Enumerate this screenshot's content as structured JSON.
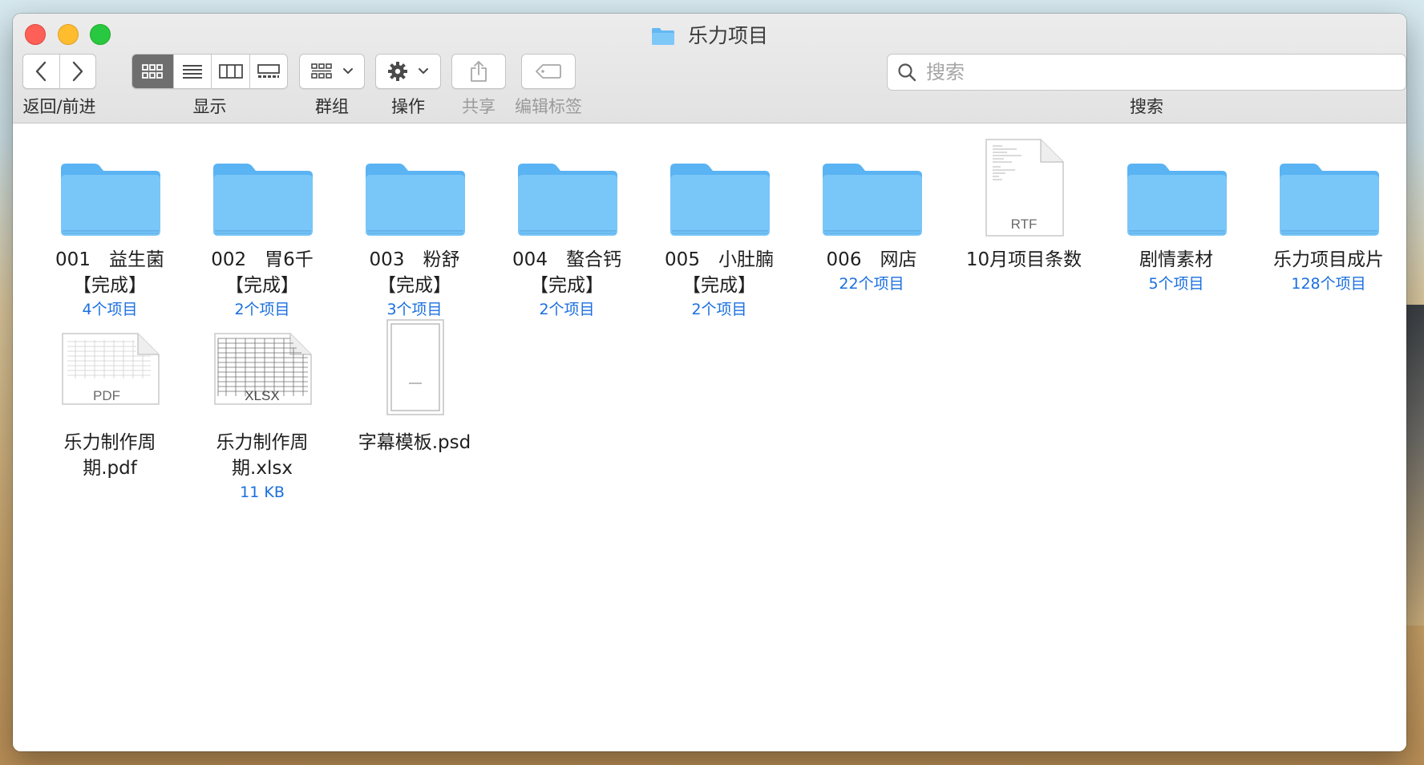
{
  "window": {
    "title": "乐力项目"
  },
  "toolbar": {
    "nav_label": "返回/前进",
    "view_label": "显示",
    "group_label": "群组",
    "action_label": "操作",
    "share_label": "共享",
    "tags_label": "编辑标签",
    "search_label": "搜索",
    "search_placeholder": "搜索",
    "active_view": "icon"
  },
  "items": [
    {
      "type": "folder",
      "name_line1": "001　益生菌",
      "name_line2": "【完成】",
      "meta": "4个项目"
    },
    {
      "type": "folder",
      "name_line1": "002　胃6千",
      "name_line2": "【完成】",
      "meta": "2个项目"
    },
    {
      "type": "folder",
      "name_line1": "003　粉舒",
      "name_line2": "【完成】",
      "meta": "3个项目"
    },
    {
      "type": "folder",
      "name_line1": "004　螯合钙",
      "name_line2": "【完成】",
      "meta": "2个项目"
    },
    {
      "type": "folder",
      "name_line1": "005　小肚腩",
      "name_line2": "【完成】",
      "meta": "2个项目"
    },
    {
      "type": "folder",
      "name_line1": "006　网店",
      "name_line2": "",
      "meta": "22个项目"
    },
    {
      "type": "rtf",
      "name_line1": "10月项目条数",
      "name_line2": "",
      "meta": "",
      "badge": "RTF"
    },
    {
      "type": "folder",
      "name_line1": "剧情素材",
      "name_line2": "",
      "meta": "5个项目"
    },
    {
      "type": "folder",
      "name_line1": "乐力项目成片",
      "name_line2": "",
      "meta": "128个项目"
    },
    {
      "type": "pdf",
      "name_line1": "乐力制作周",
      "name_line2": "期.pdf",
      "meta": "",
      "badge": "PDF"
    },
    {
      "type": "xlsx",
      "name_line1": "乐力制作周",
      "name_line2": "期.xlsx",
      "meta": "11 KB",
      "badge": "XLSX"
    },
    {
      "type": "psd",
      "name_line1": "字幕模板.psd",
      "name_line2": "",
      "meta": ""
    }
  ],
  "colors": {
    "folder_top": "#7fc8f8",
    "folder_body": "#5bb5f5",
    "meta_blue": "#1a6fe0",
    "active_segment": "#6e6e6e"
  }
}
